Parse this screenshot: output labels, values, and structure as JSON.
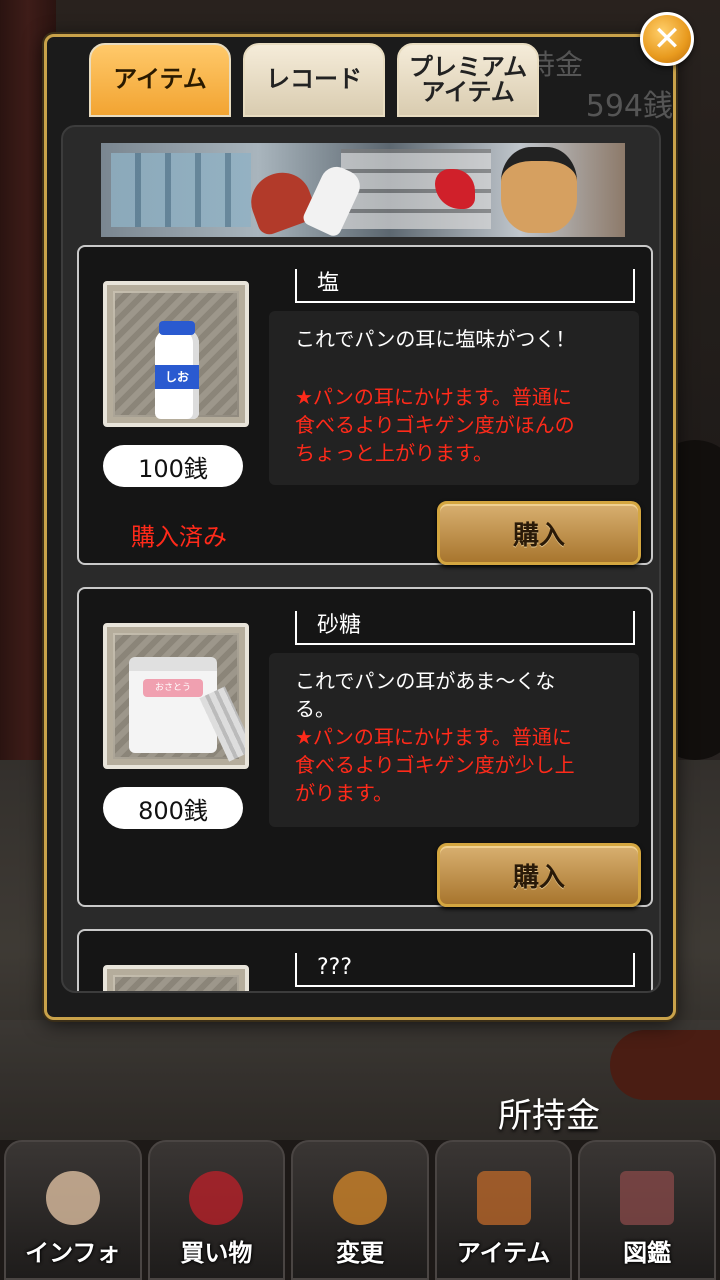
{
  "tabs": [
    {
      "label": "アイテム",
      "active": true
    },
    {
      "label": "レコード",
      "active": false
    },
    {
      "label": "プレミアム\nアイテム",
      "active": false
    }
  ],
  "close_icon": "close-icon",
  "money": {
    "label": "所持金",
    "value": "594銭"
  },
  "items": [
    {
      "name": "塩",
      "price": "100銭",
      "status": "購入済み",
      "description": "これでパンの耳に塩味がつく！",
      "note": "★パンの耳にかけます。普通に\n食べるよりゴキゲン度がほんの\nちょっと上がります。",
      "buy_label": "購入"
    },
    {
      "name": "砂糖",
      "price": "800銭",
      "status": "",
      "description": "これでパンの耳があま～くな\nる。",
      "note": "★パンの耳にかけます。普通に\n食べるよりゴキゲン度が少し上\nがります。",
      "buy_label": "購入"
    },
    {
      "name": "???"
    }
  ],
  "bottom_nav": [
    {
      "label": "インフォ",
      "icon": "person-icon"
    },
    {
      "label": "買い物",
      "icon": "purse-icon"
    },
    {
      "label": "変更",
      "icon": "swap-icon"
    },
    {
      "label": "アイテム",
      "icon": "box-icon"
    },
    {
      "label": "図鑑",
      "icon": "book-icon"
    }
  ],
  "colors": {
    "accent": "#f2a432",
    "warning_text": "#ff2a1a",
    "frame": "#c9a24a"
  }
}
